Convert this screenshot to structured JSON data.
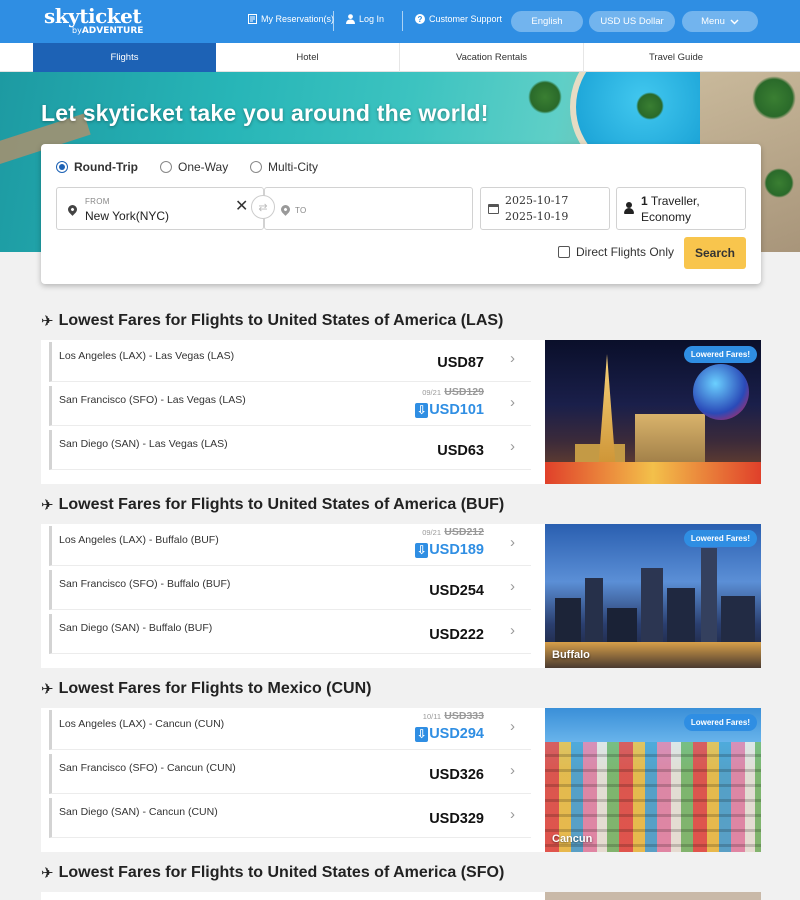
{
  "header": {
    "logo": "skyticket",
    "logo_sub_prefix": "by",
    "logo_sub_brand": "ADVENTURE",
    "my_reservations": "My Reservation(s)",
    "login": "Log In",
    "support": "Customer Support",
    "language": "English",
    "currency": "USD US Dollar",
    "menu": "Menu"
  },
  "tabs": [
    {
      "label": "Flights",
      "active": true
    },
    {
      "label": "Hotel"
    },
    {
      "label": "Vacation Rentals"
    },
    {
      "label": "Travel Guide"
    }
  ],
  "hero": {
    "headline": "Let skyticket take you around the world!"
  },
  "search": {
    "trip_types": [
      "Round-Trip",
      "One-Way",
      "Multi-City"
    ],
    "selected_trip_type": "Round-Trip",
    "from_label": "FROM",
    "from_value": "New York(NYC)",
    "to_label": "TO",
    "depart_date": "2025-10-17",
    "return_date": "2025-10-19",
    "travellers_count": "1",
    "travellers_text": "Traveller,",
    "cabin": "Economy",
    "direct_only_label": "Direct Flights Only",
    "direct_only_checked": false,
    "search_button": "Search"
  },
  "sections": [
    {
      "title": "Lowest Fares for Flights to United States of America (LAS)",
      "badge": "Lowered Fares!",
      "city_label": "",
      "routes": [
        {
          "name": "Los Angeles (LAX) - Las Vegas (LAS)",
          "price": "USD87"
        },
        {
          "name": "San Francisco (SFO) - Las Vegas (LAS)",
          "old_date": "09/21",
          "old_price": "USD129",
          "price": "USD101",
          "lowered": true
        },
        {
          "name": "San Diego (SAN) - Las Vegas (LAS)",
          "price": "USD63"
        }
      ]
    },
    {
      "title": "Lowest Fares for Flights to United States of America (BUF)",
      "badge": "Lowered Fares!",
      "city_label": "Buffalo",
      "routes": [
        {
          "name": "Los Angeles (LAX) - Buffalo (BUF)",
          "old_date": "09/21",
          "old_price": "USD212",
          "price": "USD189",
          "lowered": true
        },
        {
          "name": "San Francisco (SFO) - Buffalo (BUF)",
          "price": "USD254"
        },
        {
          "name": "San Diego (SAN) - Buffalo (BUF)",
          "price": "USD222"
        }
      ]
    },
    {
      "title": "Lowest Fares for Flights to Mexico (CUN)",
      "badge": "Lowered Fares!",
      "city_label": "Cancun",
      "routes": [
        {
          "name": "Los Angeles (LAX) - Cancun (CUN)",
          "old_date": "10/11",
          "old_price": "USD333",
          "price": "USD294",
          "lowered": true
        },
        {
          "name": "San Francisco (SFO) - Cancun (CUN)",
          "price": "USD326"
        },
        {
          "name": "San Diego (SAN) - Cancun (CUN)",
          "price": "USD329"
        }
      ]
    },
    {
      "title": "Lowest Fares for Flights to United States of America (SFO)"
    }
  ],
  "icons": {
    "plane": "airplane-icon",
    "chevron": "chevron-right-icon",
    "price_down": "arrow-down-icon"
  },
  "colors": {
    "brand_blue": "#2f8ee3",
    "active_tab": "#1d62b5",
    "search_button": "#f8c54d"
  }
}
